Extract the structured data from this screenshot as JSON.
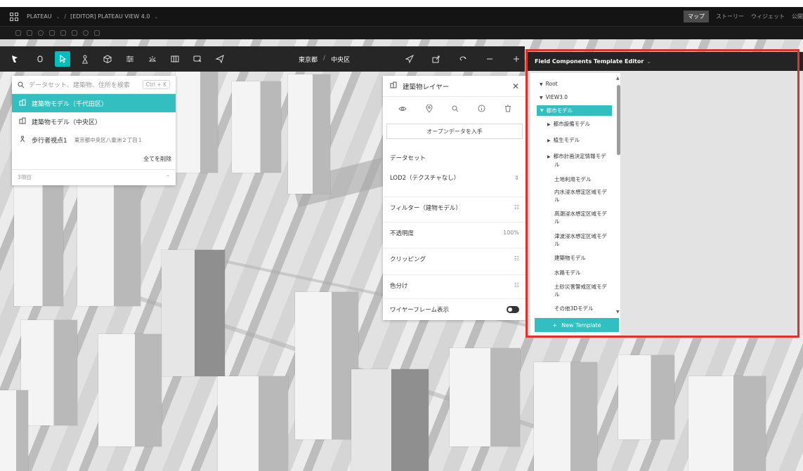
{
  "topbar": {
    "project": "PLATEAU",
    "separator": "/",
    "scene": "[EDITOR] PLATEAU VIEW 4.0",
    "tabs": [
      "マップ",
      "ストーリー",
      "ウィジェット",
      "公開"
    ]
  },
  "map_toolbar": {
    "region_pref": "東京都",
    "region_sep": "/",
    "region_ward": "中央区"
  },
  "search": {
    "placeholder": "データセット、建築物、住所を検索",
    "shortcut": "Ctrl + K"
  },
  "datasets": [
    {
      "label": "建築物モデル（千代田区）",
      "selected": true
    },
    {
      "label": "建築物モデル（中央区）",
      "selected": false
    },
    {
      "label": "歩行者視点1",
      "address": "東京都中央区八重洲２丁目１",
      "selected": false
    }
  ],
  "dataset_panel": {
    "clear_all": "全てを削除",
    "count": "3項目"
  },
  "layer_panel": {
    "title": "建築物レイヤー",
    "open_data_button": "オープンデータを入手",
    "dataset_label": "データセット",
    "dataset_value": "LOD2（テクスチャなし）",
    "filter_label": "フィルター（建物モデル）",
    "opacity_label": "不透明度",
    "opacity_value": "100%",
    "clipping_label": "クリッピング",
    "color_label": "色分け",
    "wireframe_label": "ワイヤーフレーム表示"
  },
  "editor": {
    "title": "Field Components Template Editor",
    "tree": [
      {
        "label": "Root",
        "level": 0,
        "expanded": true
      },
      {
        "label": "VIEW3.0",
        "level": 0,
        "expanded": true
      },
      {
        "label": "都市モデル",
        "level": 1,
        "expanded": true,
        "selected": true
      },
      {
        "label": "都市設備モデル",
        "level": 2,
        "collapsed": true
      },
      {
        "label": "植生モデル",
        "level": 2,
        "collapsed": true
      },
      {
        "label": "都市計画決定情報モデル",
        "level": 2,
        "collapsed": true,
        "line1": "都市計画決定情報モデ",
        "line2": "ル"
      },
      {
        "label": "土地利用モデル",
        "level": 2
      },
      {
        "label": "内水浸水想定区域モデル",
        "level": 2,
        "line1": "内水浸水想定区域モデ",
        "line2": "ル"
      },
      {
        "label": "高潮浸水想定区域モデル",
        "level": 2,
        "line1": "高潮浸水想定区域モデ",
        "line2": "ル"
      },
      {
        "label": "津波浸水想定区域モデル",
        "level": 2,
        "line1": "津波浸水想定区域モデ",
        "line2": "ル"
      },
      {
        "label": "建築物モデル",
        "level": 2
      },
      {
        "label": "水路モデル",
        "level": 2
      },
      {
        "label": "土砂災害警戒区域モデル",
        "level": 2,
        "line1": "土砂災害警戒区域モデ",
        "line2": "ル"
      },
      {
        "label": "その他3Dモデル",
        "level": 2
      }
    ],
    "new_template_button": "New Template"
  },
  "colors": {
    "accent": "#33bfbf",
    "highlight_border": "#e0312b",
    "topbar": "#141414",
    "toolbar": "#262626"
  },
  "icons": [
    "apps-icon",
    "chevron-down-icon",
    "hand-icon",
    "cursor-icon",
    "pedestrian-icon",
    "cube-icon",
    "sliders-icon",
    "sun-icon",
    "columns-icon",
    "screen-icon",
    "send-icon",
    "locate-icon",
    "share-icon",
    "rotate-icon",
    "minus-icon",
    "plus-icon",
    "compass-icon",
    "search-icon",
    "building-icon",
    "eye-icon",
    "pin-icon",
    "info-icon",
    "trash-icon",
    "close-icon"
  ]
}
